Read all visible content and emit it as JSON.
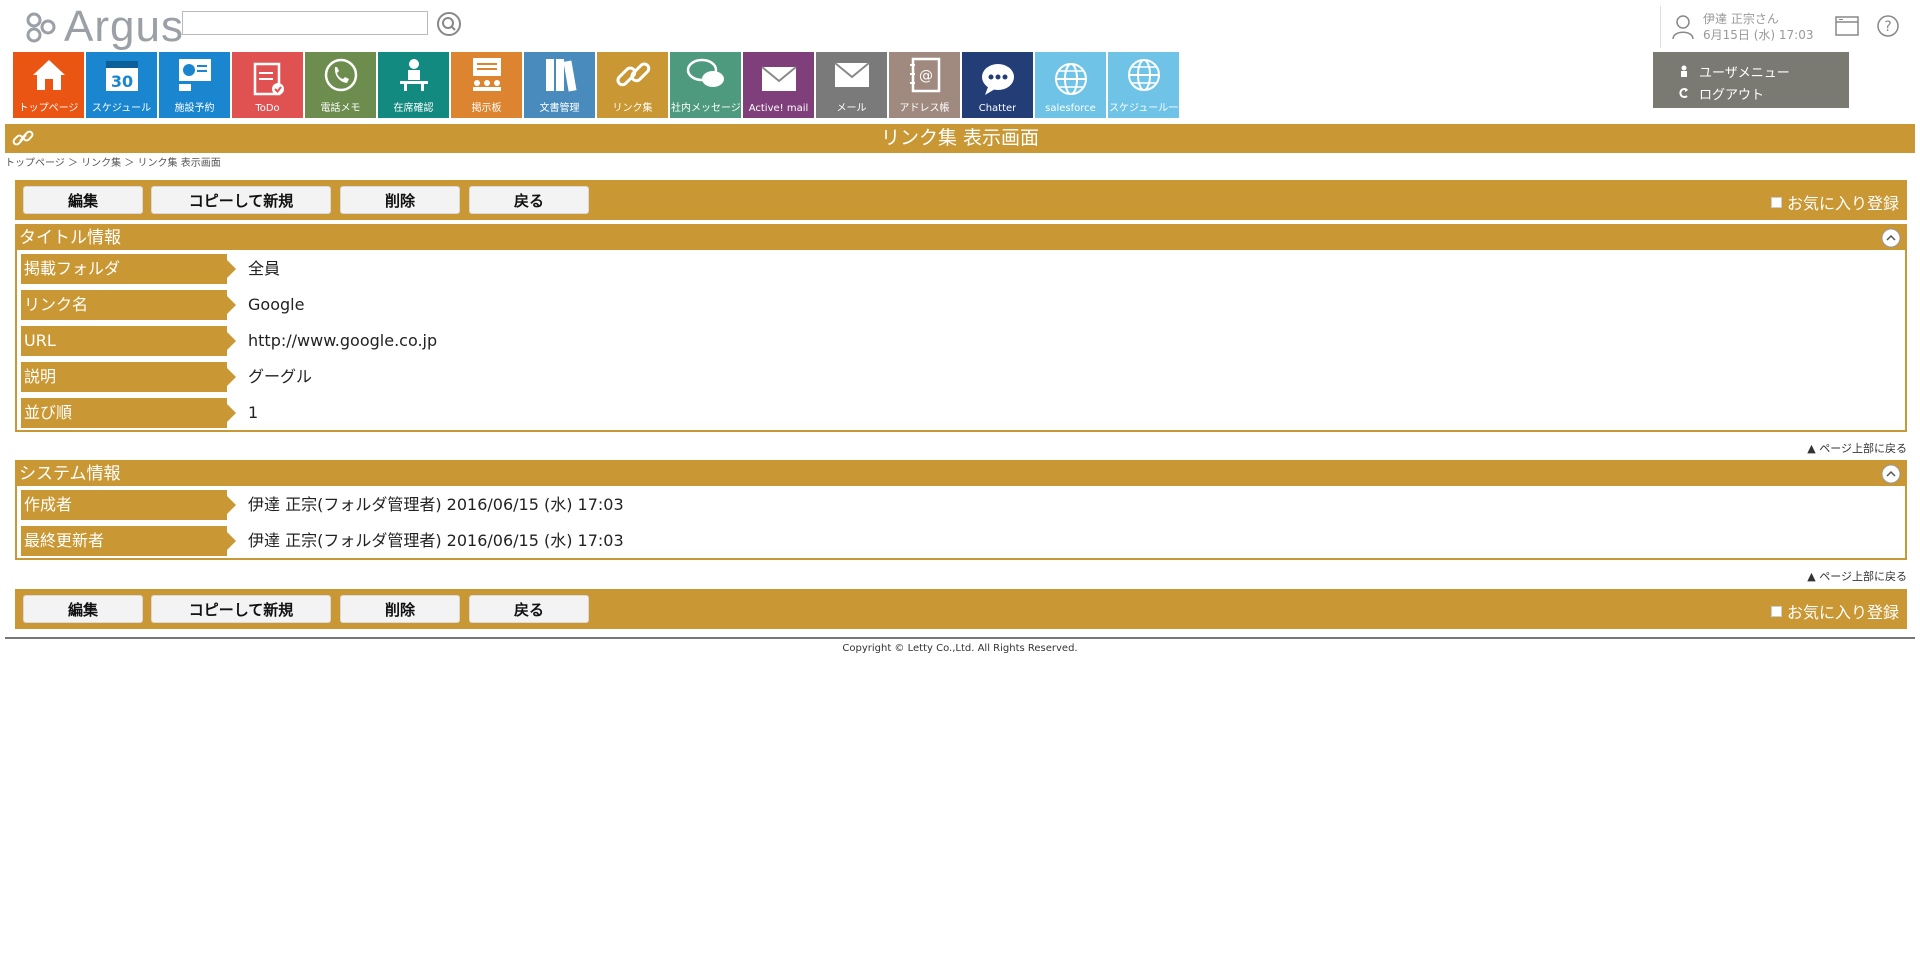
{
  "header": {
    "logo_text": "Argus",
    "search": {
      "value": "",
      "placeholder": ""
    },
    "user": {
      "name": "伊達 正宗さん",
      "datetime": "6月15日 (水) 17:03"
    },
    "user_menu": {
      "items": [
        "ユーザメニュー",
        "ログアウト"
      ]
    }
  },
  "nav": [
    {
      "label": "トップページ",
      "color": "#ea5514",
      "icon": "home-icon"
    },
    {
      "label": "スケジュール",
      "color": "#1a86d0",
      "icon": "calendar-icon"
    },
    {
      "label": "施設予約",
      "color": "#1a86d0",
      "icon": "facility-icon"
    },
    {
      "label": "ToDo",
      "color": "#e05252",
      "icon": "todo-icon"
    },
    {
      "label": "電話メモ",
      "color": "#6d8d4e",
      "icon": "phone-icon"
    },
    {
      "label": "在席確認",
      "color": "#128a7f",
      "icon": "presence-icon"
    },
    {
      "label": "掲示板",
      "color": "#dd8430",
      "icon": "board-icon"
    },
    {
      "label": "文書管理",
      "color": "#4a8bbd",
      "icon": "document-icon"
    },
    {
      "label": "リンク集",
      "color": "#c99733",
      "icon": "link-icon"
    },
    {
      "label": "社内メッセージ",
      "color": "#4e9a7e",
      "icon": "message-icon"
    },
    {
      "label": "Active! mail",
      "color": "#7e3f7a",
      "icon": "mail-icon"
    },
    {
      "label": "メール",
      "color": "#7a7a7a",
      "icon": "mail-icon"
    },
    {
      "label": "アドレス帳",
      "color": "#a08a80",
      "icon": "address-book-icon"
    },
    {
      "label": "Chatter",
      "color": "#233e77",
      "icon": "chat-icon"
    },
    {
      "label": "salesforce",
      "color": "#6ec3e6",
      "icon": "globe-icon"
    },
    {
      "label": "スケジュール一",
      "color": "#6ec3e6",
      "icon": "globe-icon"
    }
  ],
  "page": {
    "title": "リンク集 表示画面",
    "breadcrumb": "トップページ ＞ リンク集 ＞ リンク集 表示画面",
    "buttons": {
      "edit": "編集",
      "copy": "コピーして新規",
      "delete": "削除",
      "back": "戻る"
    },
    "favorite": "お気に入り登録",
    "to_top": "▲ ページ上部に戻る"
  },
  "title_info": {
    "heading": "タイトル情報",
    "rows": [
      {
        "label": "掲載フォルダ",
        "value": "全員"
      },
      {
        "label": "リンク名",
        "value": "Google"
      },
      {
        "label": "URL",
        "value": "http://www.google.co.jp"
      },
      {
        "label": "説明",
        "value": "グーグル"
      },
      {
        "label": "並び順",
        "value": "1"
      }
    ]
  },
  "system_info": {
    "heading": "システム情報",
    "rows": [
      {
        "label": "作成者",
        "value": "伊達 正宗(フォルダ管理者) 2016/06/15 (水) 17:03"
      },
      {
        "label": "最終更新者",
        "value": "伊達 正宗(フォルダ管理者) 2016/06/15 (水) 17:03"
      }
    ]
  },
  "footer": {
    "copyright": "Copyright © Letty Co.,Ltd. All Rights Reserved."
  }
}
